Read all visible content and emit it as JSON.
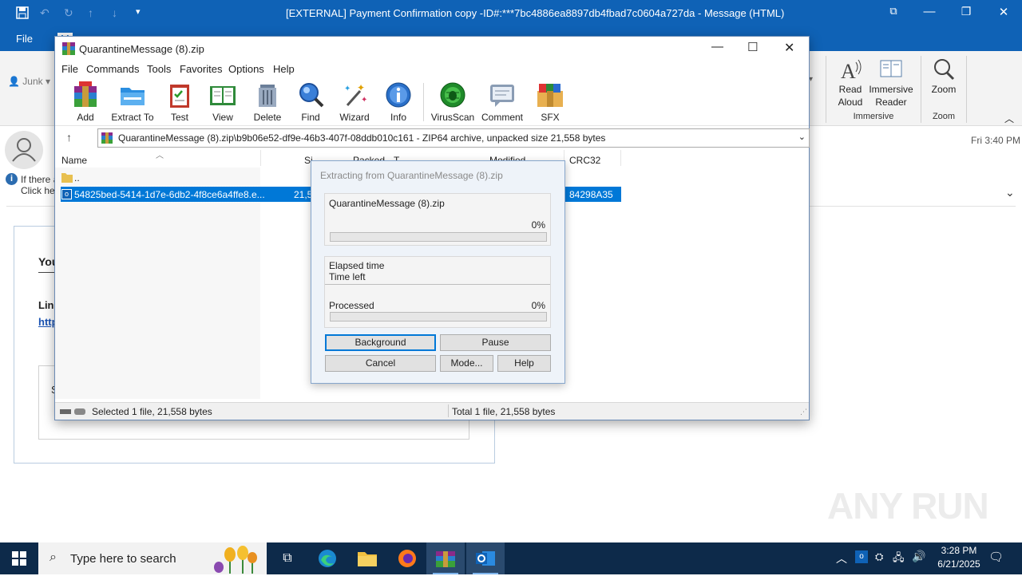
{
  "outlook": {
    "title": "[EXTERNAL] Payment Confirmation copy -ID#:***7bc4886ea8897db4fbad7c0604a727da  -  Message (HTML)",
    "file_tab": "File",
    "hidden_tab_fragment": "M",
    "junk": "Junk",
    "ribbon": {
      "read_aloud": [
        "Read",
        "Aloud"
      ],
      "immersive_reader": [
        "Immersive",
        "Reader"
      ],
      "immersive_group": "Immersive",
      "zoom": "Zoom",
      "zoom_group": "Zoom"
    },
    "header": {
      "date": "Fri 3:40 PM",
      "info_line1": "If there a",
      "info_line2": "Click her"
    },
    "body": {
      "frag_you": "You",
      "frag_lin": "Lin",
      "frag_link": "http",
      "frag_s": "S"
    }
  },
  "winrar": {
    "title": "QuarantineMessage (8).zip",
    "menu": [
      "File",
      "Commands",
      "Tools",
      "Favorites",
      "Options",
      "Help"
    ],
    "toolbar": [
      "Add",
      "Extract To",
      "Test",
      "View",
      "Delete",
      "Find",
      "Wizard",
      "Info",
      "VirusScan",
      "Comment",
      "SFX"
    ],
    "path": "QuarantineMessage (8).zip\\b9b06e52-df9e-46b3-407f-08ddb010c161 - ZIP64 archive, unpacked size 21,558 bytes",
    "columns": {
      "name": "Name",
      "size": "Si",
      "packed": "Packed",
      "type": "T",
      "modified": "Modified",
      "crc": "CRC32"
    },
    "rows": [
      {
        "name": "..",
        "size": "",
        "crc": ""
      },
      {
        "name": "54825bed-5414-1d7e-6db2-4f8ce6a4ffe8.e...",
        "size": "21,5",
        "crc": "84298A35"
      }
    ],
    "status_left": "Selected 1 file, 21,558 bytes",
    "status_right": "Total 1 file, 21,558 bytes"
  },
  "dialog": {
    "title": "Extracting from QuarantineMessage (8).zip",
    "file": "QuarantineMessage (8).zip",
    "file_pct": "0%",
    "file_progress": 0,
    "elapsed_label": "Elapsed time",
    "left_label": "Time left",
    "processed_label": "Processed",
    "processed_pct": "0%",
    "processed_progress": 0,
    "buttons": {
      "background": "Background",
      "pause": "Pause",
      "cancel": "Cancel",
      "mode": "Mode...",
      "help": "Help"
    }
  },
  "taskbar": {
    "search_placeholder": "Type here to search",
    "time": "3:28 PM",
    "date": "6/21/2025"
  },
  "watermark": "ANY RUN",
  "colors": {
    "outlook_blue": "#0f62b6",
    "selection": "#0078d7",
    "taskbar": "#0d2a4a",
    "progress": "#06b025"
  }
}
